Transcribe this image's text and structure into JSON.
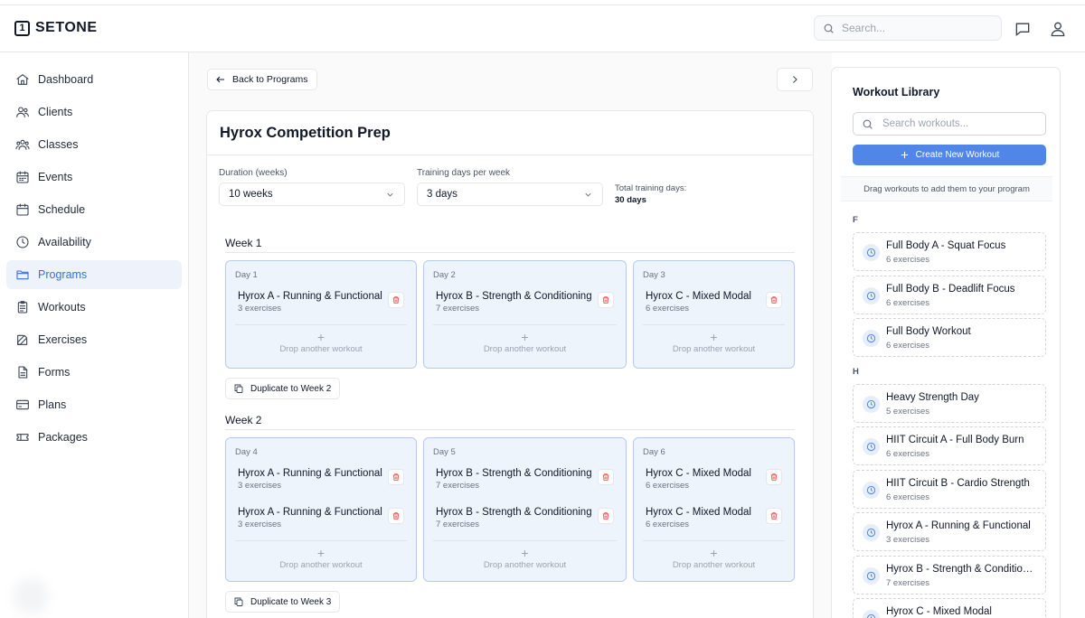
{
  "app": {
    "logo_mark": "1",
    "logo_text": "SETONE"
  },
  "header": {
    "search_placeholder": "Search...",
    "icons": [
      "chat-icon",
      "user-icon"
    ]
  },
  "sidebar": {
    "items": [
      {
        "label": "Dashboard",
        "icon": "home-icon"
      },
      {
        "label": "Clients",
        "icon": "clients-icon"
      },
      {
        "label": "Classes",
        "icon": "classes-icon"
      },
      {
        "label": "Events",
        "icon": "events-icon"
      },
      {
        "label": "Schedule",
        "icon": "calendar-icon"
      },
      {
        "label": "Availability",
        "icon": "clock-icon"
      },
      {
        "label": "Programs",
        "icon": "folder-icon",
        "active": true
      },
      {
        "label": "Workouts",
        "icon": "clipboard-icon"
      },
      {
        "label": "Exercises",
        "icon": "edit-icon"
      },
      {
        "label": "Forms",
        "icon": "document-icon"
      },
      {
        "label": "Plans",
        "icon": "card-icon"
      },
      {
        "label": "Packages",
        "icon": "ticket-icon"
      }
    ]
  },
  "main": {
    "back_label": "Back to Programs",
    "program_title": "Hyrox Competition Prep",
    "duration": {
      "label": "Duration (weeks)",
      "value": "10 weeks"
    },
    "training_days": {
      "label": "Training days per week",
      "value": "3 days"
    },
    "total": {
      "label": "Total training days:",
      "value": "30 days"
    },
    "drop_label": "Drop another workout",
    "weeks": [
      {
        "title": "Week 1",
        "duplicate_label": "Duplicate to Week 2",
        "days": [
          {
            "label": "Day 1",
            "workouts": [
              {
                "name": "Hyrox A - Running & Functional",
                "count": "3 exercises"
              }
            ]
          },
          {
            "label": "Day 2",
            "workouts": [
              {
                "name": "Hyrox B - Strength & Conditioning",
                "count": "7 exercises"
              }
            ]
          },
          {
            "label": "Day 3",
            "workouts": [
              {
                "name": "Hyrox C - Mixed Modal",
                "count": "6 exercises"
              }
            ]
          }
        ]
      },
      {
        "title": "Week 2",
        "duplicate_label": "Duplicate to Week 3",
        "days": [
          {
            "label": "Day 4",
            "workouts": [
              {
                "name": "Hyrox A - Running & Functional",
                "count": "3 exercises"
              },
              {
                "name": "Hyrox A - Running & Functional",
                "count": "3 exercises"
              }
            ]
          },
          {
            "label": "Day 5",
            "workouts": [
              {
                "name": "Hyrox B - Strength & Conditioning",
                "count": "7 exercises"
              },
              {
                "name": "Hyrox B - Strength & Conditioning",
                "count": "7 exercises"
              }
            ]
          },
          {
            "label": "Day 6",
            "workouts": [
              {
                "name": "Hyrox C - Mixed Modal",
                "count": "6 exercises"
              },
              {
                "name": "Hyrox C - Mixed Modal",
                "count": "6 exercises"
              }
            ]
          }
        ]
      }
    ]
  },
  "library": {
    "title": "Workout Library",
    "search_placeholder": "Search workouts...",
    "create_label": "Create New Workout",
    "hint": "Drag workouts to add them to your program",
    "groups": [
      {
        "letter": "F",
        "items": [
          {
            "name": "Full Body A - Squat Focus",
            "count": "6 exercises"
          },
          {
            "name": "Full Body B - Deadlift Focus",
            "count": "6 exercises"
          },
          {
            "name": "Full Body Workout",
            "count": "6 exercises"
          }
        ]
      },
      {
        "letter": "H",
        "items": [
          {
            "name": "Heavy Strength Day",
            "count": "5 exercises"
          },
          {
            "name": "HIIT Circuit A - Full Body Burn",
            "count": "6 exercises"
          },
          {
            "name": "HIIT Circuit B - Cardio Strength",
            "count": "6 exercises"
          },
          {
            "name": "Hyrox A - Running & Functional",
            "count": "3 exercises"
          },
          {
            "name": "Hyrox B - Strength & Conditioning",
            "count": "7 exercises"
          },
          {
            "name": "Hyrox C - Mixed Modal",
            "count": ""
          }
        ]
      }
    ]
  },
  "colors": {
    "accent": "#4f86e8",
    "active_nav_bg": "#eef2fb",
    "active_nav_text": "#3b6fd9",
    "day_bg": "#eef4fc",
    "day_border": "#b7ccec",
    "trash": "#ef4444"
  }
}
